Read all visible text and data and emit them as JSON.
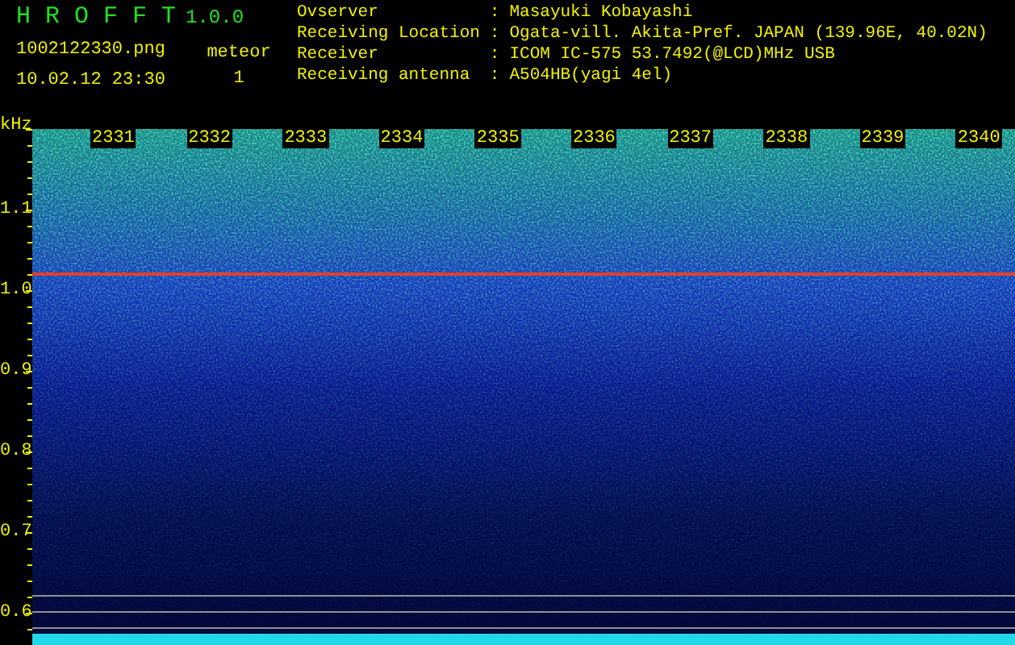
{
  "app": {
    "name": "H R O F F T",
    "version": "1.0.0"
  },
  "file": "1002122330.png",
  "datetime": "10.02.12 23:30",
  "meteor": {
    "label": "meteor",
    "count": "1"
  },
  "station": [
    {
      "label": "Ovserver",
      "separator": ":",
      "value": "Masayuki Kobayashi"
    },
    {
      "label": "Receiving Location",
      "separator": ":",
      "value": "Ogata-vill. Akita-Pref. JAPAN (139.96E, 40.02N)"
    },
    {
      "label": "Receiver",
      "separator": ":",
      "value": "ICOM IC-575 53.7492(@LCD)MHz USB"
    },
    {
      "label": "Receiving antenna",
      "separator": ":",
      "value": "A504HB(yagi 4el)"
    }
  ],
  "spectrogram": {
    "unit": "kHz",
    "time_labels": [
      "2331",
      "2332",
      "2333",
      "2334",
      "2335",
      "2336",
      "2337",
      "2338",
      "2339",
      "2340"
    ],
    "freq_labels": [
      "1.1",
      "1.0",
      "0.9",
      "0.8",
      "0.7",
      "0.6"
    ]
  }
}
